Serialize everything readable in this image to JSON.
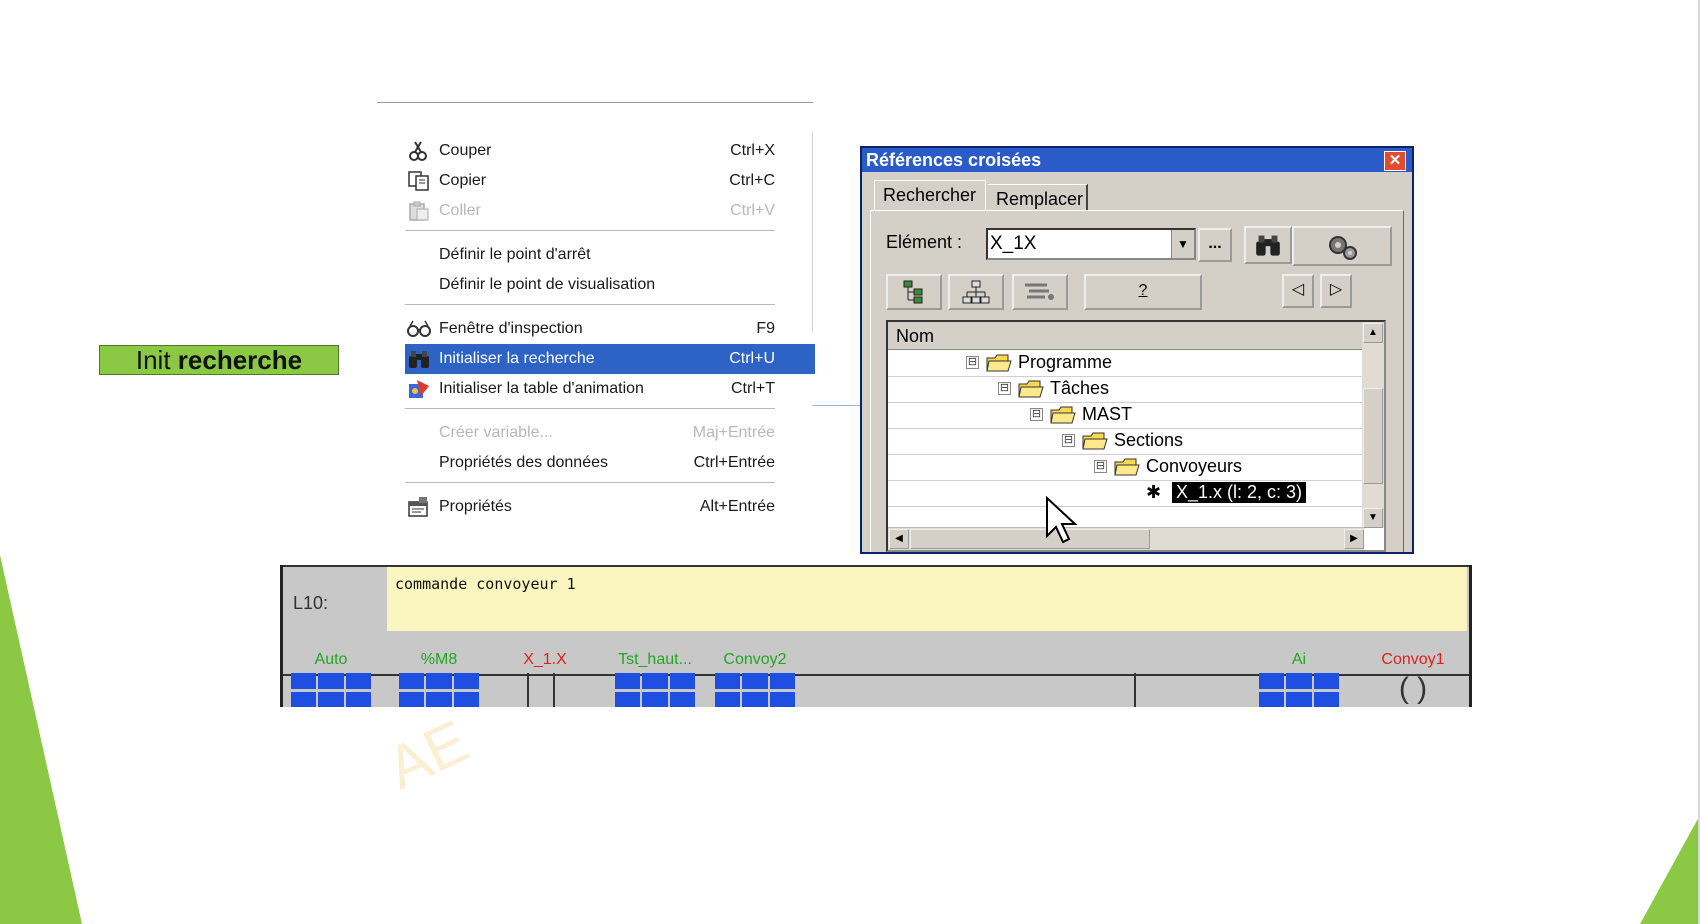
{
  "slide": {
    "label_prefix": "Init ",
    "label_bold": "recherche",
    "accent_color": "#8bc945"
  },
  "context_menu": {
    "items": [
      {
        "label": "Couper",
        "shortcut": "Ctrl+X",
        "icon": "scissors-icon",
        "disabled": false
      },
      {
        "label": "Copier",
        "shortcut": "Ctrl+C",
        "icon": "copy-icon",
        "disabled": false
      },
      {
        "label": "Coller",
        "shortcut": "Ctrl+V",
        "icon": "paste-icon",
        "disabled": true
      },
      {
        "label": "Définir le point d'arrêt",
        "shortcut": "",
        "icon": "",
        "disabled": false
      },
      {
        "label": "Définir le point de visualisation",
        "shortcut": "",
        "icon": "",
        "disabled": false
      },
      {
        "label": "Fenêtre d'inspection",
        "shortcut": "F9",
        "icon": "glasses-icon",
        "disabled": false
      },
      {
        "label": "Initialiser la recherche",
        "shortcut": "Ctrl+U",
        "icon": "binoculars-icon",
        "disabled": false,
        "selected": true
      },
      {
        "label": "Initialiser la table d'animation",
        "shortcut": "Ctrl+T",
        "icon": "animation-table-icon",
        "disabled": false
      },
      {
        "label": "Créer variable...",
        "shortcut": "Maj+Entrée",
        "icon": "",
        "disabled": true
      },
      {
        "label": "Propriétés des données",
        "shortcut": "Ctrl+Entrée",
        "icon": "",
        "disabled": false
      },
      {
        "label": "Propriétés",
        "shortcut": "Alt+Entrée",
        "icon": "properties-icon",
        "disabled": false
      }
    ],
    "selection_color": "#2d63c4"
  },
  "dialog": {
    "title": "Références croisées",
    "close_label": "✕",
    "tabs": [
      "Rechercher",
      "Remplacer"
    ],
    "element_label": "Elément :",
    "element_value": "X_1X",
    "browse_label": "...",
    "help_label": "?",
    "tree": {
      "column_header": "Nom",
      "nodes": [
        {
          "label": "Programme",
          "toggle": "⊟"
        },
        {
          "label": "Tâches",
          "toggle": "⊟"
        },
        {
          "label": "MAST",
          "toggle": "⊟"
        },
        {
          "label": "Sections",
          "toggle": "⊟"
        },
        {
          "label": "Convoyeurs",
          "toggle": "⊟"
        },
        {
          "label": "X_1.x (l: 2, c: 3)",
          "toggle": ""
        }
      ]
    },
    "title_color": "#2a5bc8"
  },
  "ladder": {
    "line_label": "L10:",
    "comment": "commande convoyeur 1",
    "contacts": [
      "Auto",
      "%M8",
      "X_1.X",
      "Tst_haut...",
      "Convoy2",
      "Ai"
    ],
    "coil": "Convoy1",
    "coil_symbol": "( )",
    "contact_color": "#1f4fe0",
    "label_green": "#22a622",
    "label_red": "#e02020"
  }
}
